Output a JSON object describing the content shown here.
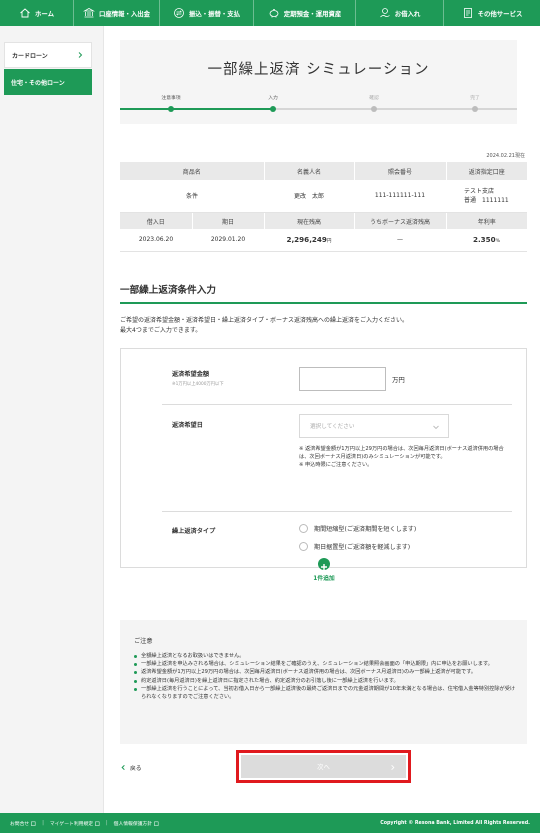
{
  "nav": {
    "items": [
      {
        "label": "ホーム",
        "icon": "home-icon"
      },
      {
        "label": "口座情報・入出金",
        "icon": "bank-icon"
      },
      {
        "label": "振込・振替・支払",
        "icon": "transfer-icon"
      },
      {
        "label": "定期預金・運用資産",
        "icon": "piggy-bank-icon"
      },
      {
        "label": "お借入れ",
        "icon": "loan-icon"
      },
      {
        "label": "その他サービス",
        "icon": "document-icon"
      }
    ]
  },
  "sidebar": {
    "items": [
      {
        "label": "カードローン",
        "active": false
      },
      {
        "label": "住宅・その他ローン",
        "active": true
      }
    ]
  },
  "page": {
    "title": "一部繰上返済 シミュレーション",
    "steps": [
      {
        "label": "注意事項",
        "state": "done"
      },
      {
        "label": "入力",
        "state": "current"
      },
      {
        "label": "確認",
        "state": "todo"
      },
      {
        "label": "完了",
        "state": "todo"
      }
    ],
    "as_of": "2024.02.21現在"
  },
  "loan": {
    "headers1": [
      "商品名",
      "名義人名",
      "照会番号",
      "返済指定口座"
    ],
    "product": "条件",
    "holder": "更改　太郎",
    "ref_no": "111-111111-111",
    "account_branch": "テスト支店",
    "account_no": "普通　1111111",
    "headers2": [
      "借入日",
      "期日",
      "現在残高",
      "うちボーナス返済残高",
      "年利率"
    ],
    "borrow_date": "2023.06.20",
    "due_date": "2029.01.20",
    "balance": "2,296,249",
    "balance_unit": "円",
    "bonus_balance": "—",
    "rate": "2.350",
    "rate_unit": "%"
  },
  "section": {
    "title": "一部繰上返済条件入力",
    "desc_line1": "ご希望の返済希望金額・返済希望日・繰上返済タイプ・ボーナス返済残高への繰上返済をご入力ください。",
    "desc_line2": "最大4つまでご入力できます。"
  },
  "form": {
    "amount_label": "返済希望金額",
    "amount_sub": "※1万円以上4000万円以下",
    "amount_value": "",
    "amount_unit": "万円",
    "date_label": "返済希望日",
    "date_placeholder": "選択してください",
    "note1": "※ 返済希望金額が1万円以上29万円の場合は、次回毎月返済日(ボーナス返済併用の場合は、次回ボーナス月返済日)のみシミュレーションが可能です。",
    "note2": "※ 申込時限にご注意ください。",
    "type_label": "繰上返済タイプ",
    "type_options": [
      "期間短縮型(ご返済期間を短くします)",
      "期日据置型(ご返済額を軽減します)"
    ]
  },
  "add": {
    "label": "1件追加"
  },
  "caution": {
    "title": "ご注意",
    "items": [
      "全額繰上返済となるお取扱いはできません。",
      "一部繰上返済を申込みされる場合は、シミュレーション結果をご確認のうえ、シミュレーション結果照会画面の「申込期限」内に申込をお願いします。",
      "返済希望金額が1万円以上29万円の場合は、次回毎月返済日(ボーナス返済併用の場合は、次回ボーナス月返済日)のみ一部繰上返済が可能です。",
      "約定返済日(毎月返済日)を繰上返済日に指定された場合、約定返済分のお引落し後に一部繰上返済を行います。",
      "一部繰上返済を行うことによって、当初お借入日から一部繰上返済後の最終ご返済日までの元金返済期間が10年未満となる場合は、住宅借入金等特別控除が受けられなくなりますのでご注意ください。"
    ]
  },
  "buttons": {
    "back": "戻る",
    "next": "次へ"
  },
  "footer": {
    "links": [
      "お問合せ",
      "マイゲート利用規定",
      "個人情報保護方針"
    ],
    "copyright": "Copyright © Resona Bank, Limited All Rights Reserved."
  },
  "colors": {
    "brand_green": "#1e9a57",
    "highlight_red": "#e0191e"
  }
}
